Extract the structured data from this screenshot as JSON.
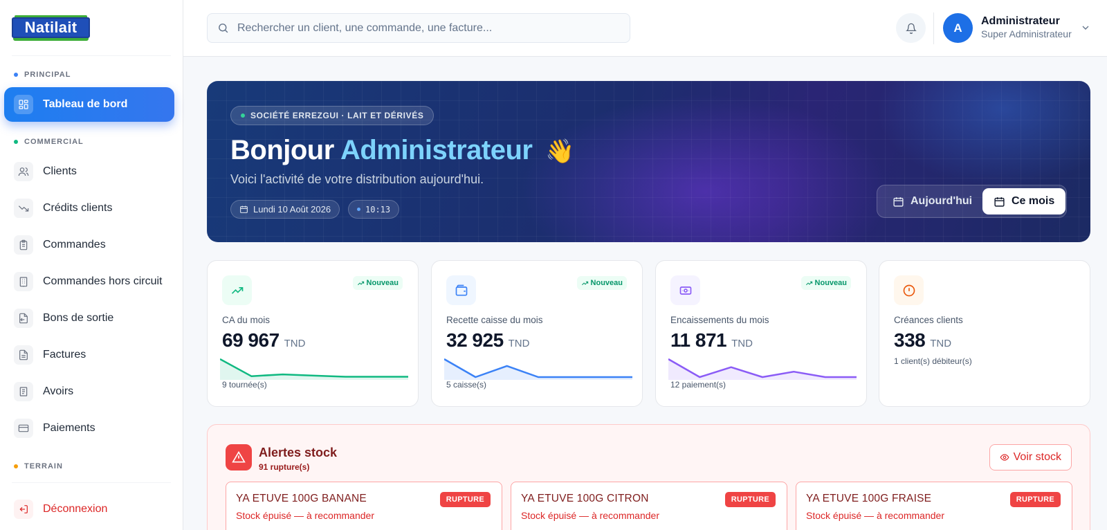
{
  "brand": {
    "logo_text": "Natilait"
  },
  "sidebar": {
    "sections": {
      "principal": "PRINCIPAL",
      "commercial": "COMMERCIAL",
      "terrain": "TERRAIN"
    },
    "items": [
      {
        "label": "Tableau de bord",
        "icon": "dashboard-icon",
        "active": true
      },
      {
        "label": "Clients",
        "icon": "users-icon"
      },
      {
        "label": "Crédits clients",
        "icon": "trending-down-icon"
      },
      {
        "label": "Commandes",
        "icon": "clipboard-icon"
      },
      {
        "label": "Commandes hors circuit",
        "icon": "building-icon"
      },
      {
        "label": "Bons de sortie",
        "icon": "file-export-icon"
      },
      {
        "label": "Factures",
        "icon": "file-text-icon"
      },
      {
        "label": "Avoirs",
        "icon": "receipt-icon"
      },
      {
        "label": "Paiements",
        "icon": "credit-card-icon"
      }
    ],
    "logout": "Déconnexion"
  },
  "topbar": {
    "search_placeholder": "Rechercher un client, une commande, une facture...",
    "user": {
      "initial": "A",
      "name": "Administrateur",
      "role": "Super Administrateur"
    }
  },
  "hero": {
    "badge": "SOCIÉTÉ ERREZGUI · LAIT ET DÉRIVÉS",
    "greeting": "Bonjour",
    "name": "Administrateur",
    "emoji": "👋",
    "subtitle": "Voici l'activité de votre distribution aujourd'hui.",
    "date": "Lundi 10 Août 2026",
    "time": "10:13",
    "period": {
      "today": "Aujourd'hui",
      "month": "Ce mois",
      "selected": "month"
    }
  },
  "kpis": [
    {
      "label": "CA du mois",
      "value": "69 967",
      "unit": "TND",
      "footer": "9 tournée(s)",
      "badge": "Nouveau",
      "color": "#10b981",
      "bg": "#ecfdf5",
      "icon": "trending-up-icon",
      "spark": [
        1.0,
        0.05,
        0.15,
        0.08,
        0.02,
        0.02,
        0.02
      ]
    },
    {
      "label": "Recette caisse du mois",
      "value": "32 925",
      "unit": "TND",
      "footer": "5 caisse(s)",
      "badge": "Nouveau",
      "color": "#3b82f6",
      "bg": "#eff6ff",
      "icon": "wallet-icon",
      "spark": [
        1.0,
        0.0,
        0.62,
        0.0,
        0.0,
        0.0,
        0.0
      ]
    },
    {
      "label": "Encaissements du mois",
      "value": "11 871",
      "unit": "TND",
      "footer": "12 paiement(s)",
      "badge": "Nouveau",
      "color": "#8b5cf6",
      "bg": "#f5f3ff",
      "icon": "banknote-icon",
      "spark": [
        1.0,
        0.0,
        0.55,
        0.0,
        0.3,
        0.0,
        0.0
      ]
    },
    {
      "label": "Créances clients",
      "value": "338",
      "unit": "TND",
      "footer": "1 client(s) débiteur(s)",
      "badge": "",
      "color": "#ea580c",
      "bg": "#fff7ed",
      "icon": "alert-circle-icon"
    }
  ],
  "alerts": {
    "title": "Alertes stock",
    "count": "91 rupture(s)",
    "button": "Voir stock",
    "items": [
      {
        "name": "YA ETUVE 100G BANANE",
        "tag": "RUPTURE",
        "desc": "Stock épuisé — à recommander"
      },
      {
        "name": "YA ETUVE 100G CITRON",
        "tag": "RUPTURE",
        "desc": "Stock épuisé — à recommander"
      },
      {
        "name": "YA ETUVE 100G FRAISE",
        "tag": "RUPTURE",
        "desc": "Stock épuisé — à recommander"
      }
    ]
  }
}
